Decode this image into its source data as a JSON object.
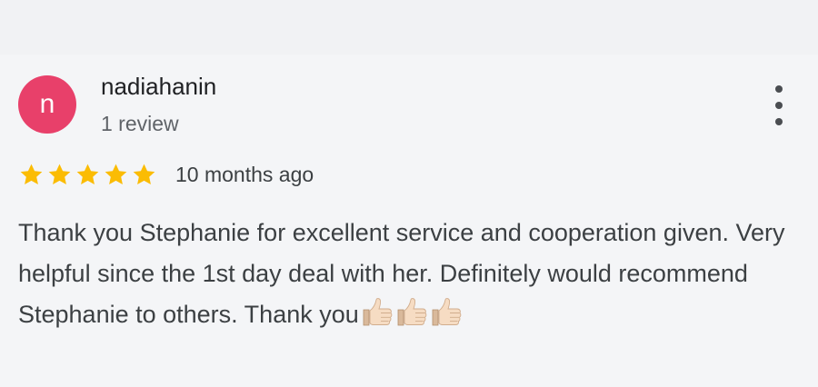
{
  "review": {
    "author": {
      "initial": "n",
      "name": "nadiahanin",
      "review_count_label": "1 review",
      "avatar_color": "#e8406a"
    },
    "rating": 5,
    "max_rating": 5,
    "star_color": "#fbbc04",
    "time_ago": "10 months ago",
    "text": "Thank you Stephanie for excellent service and cooperation given. Very helpful since the 1st day deal with her. Definitely would recommend Stephanie to others. Thank you",
    "trailing_emoji": [
      "thumbs-up-light-skin",
      "thumbs-up-light-skin",
      "thumbs-up-light-skin"
    ],
    "menu_icon": "more-vert-icon"
  }
}
